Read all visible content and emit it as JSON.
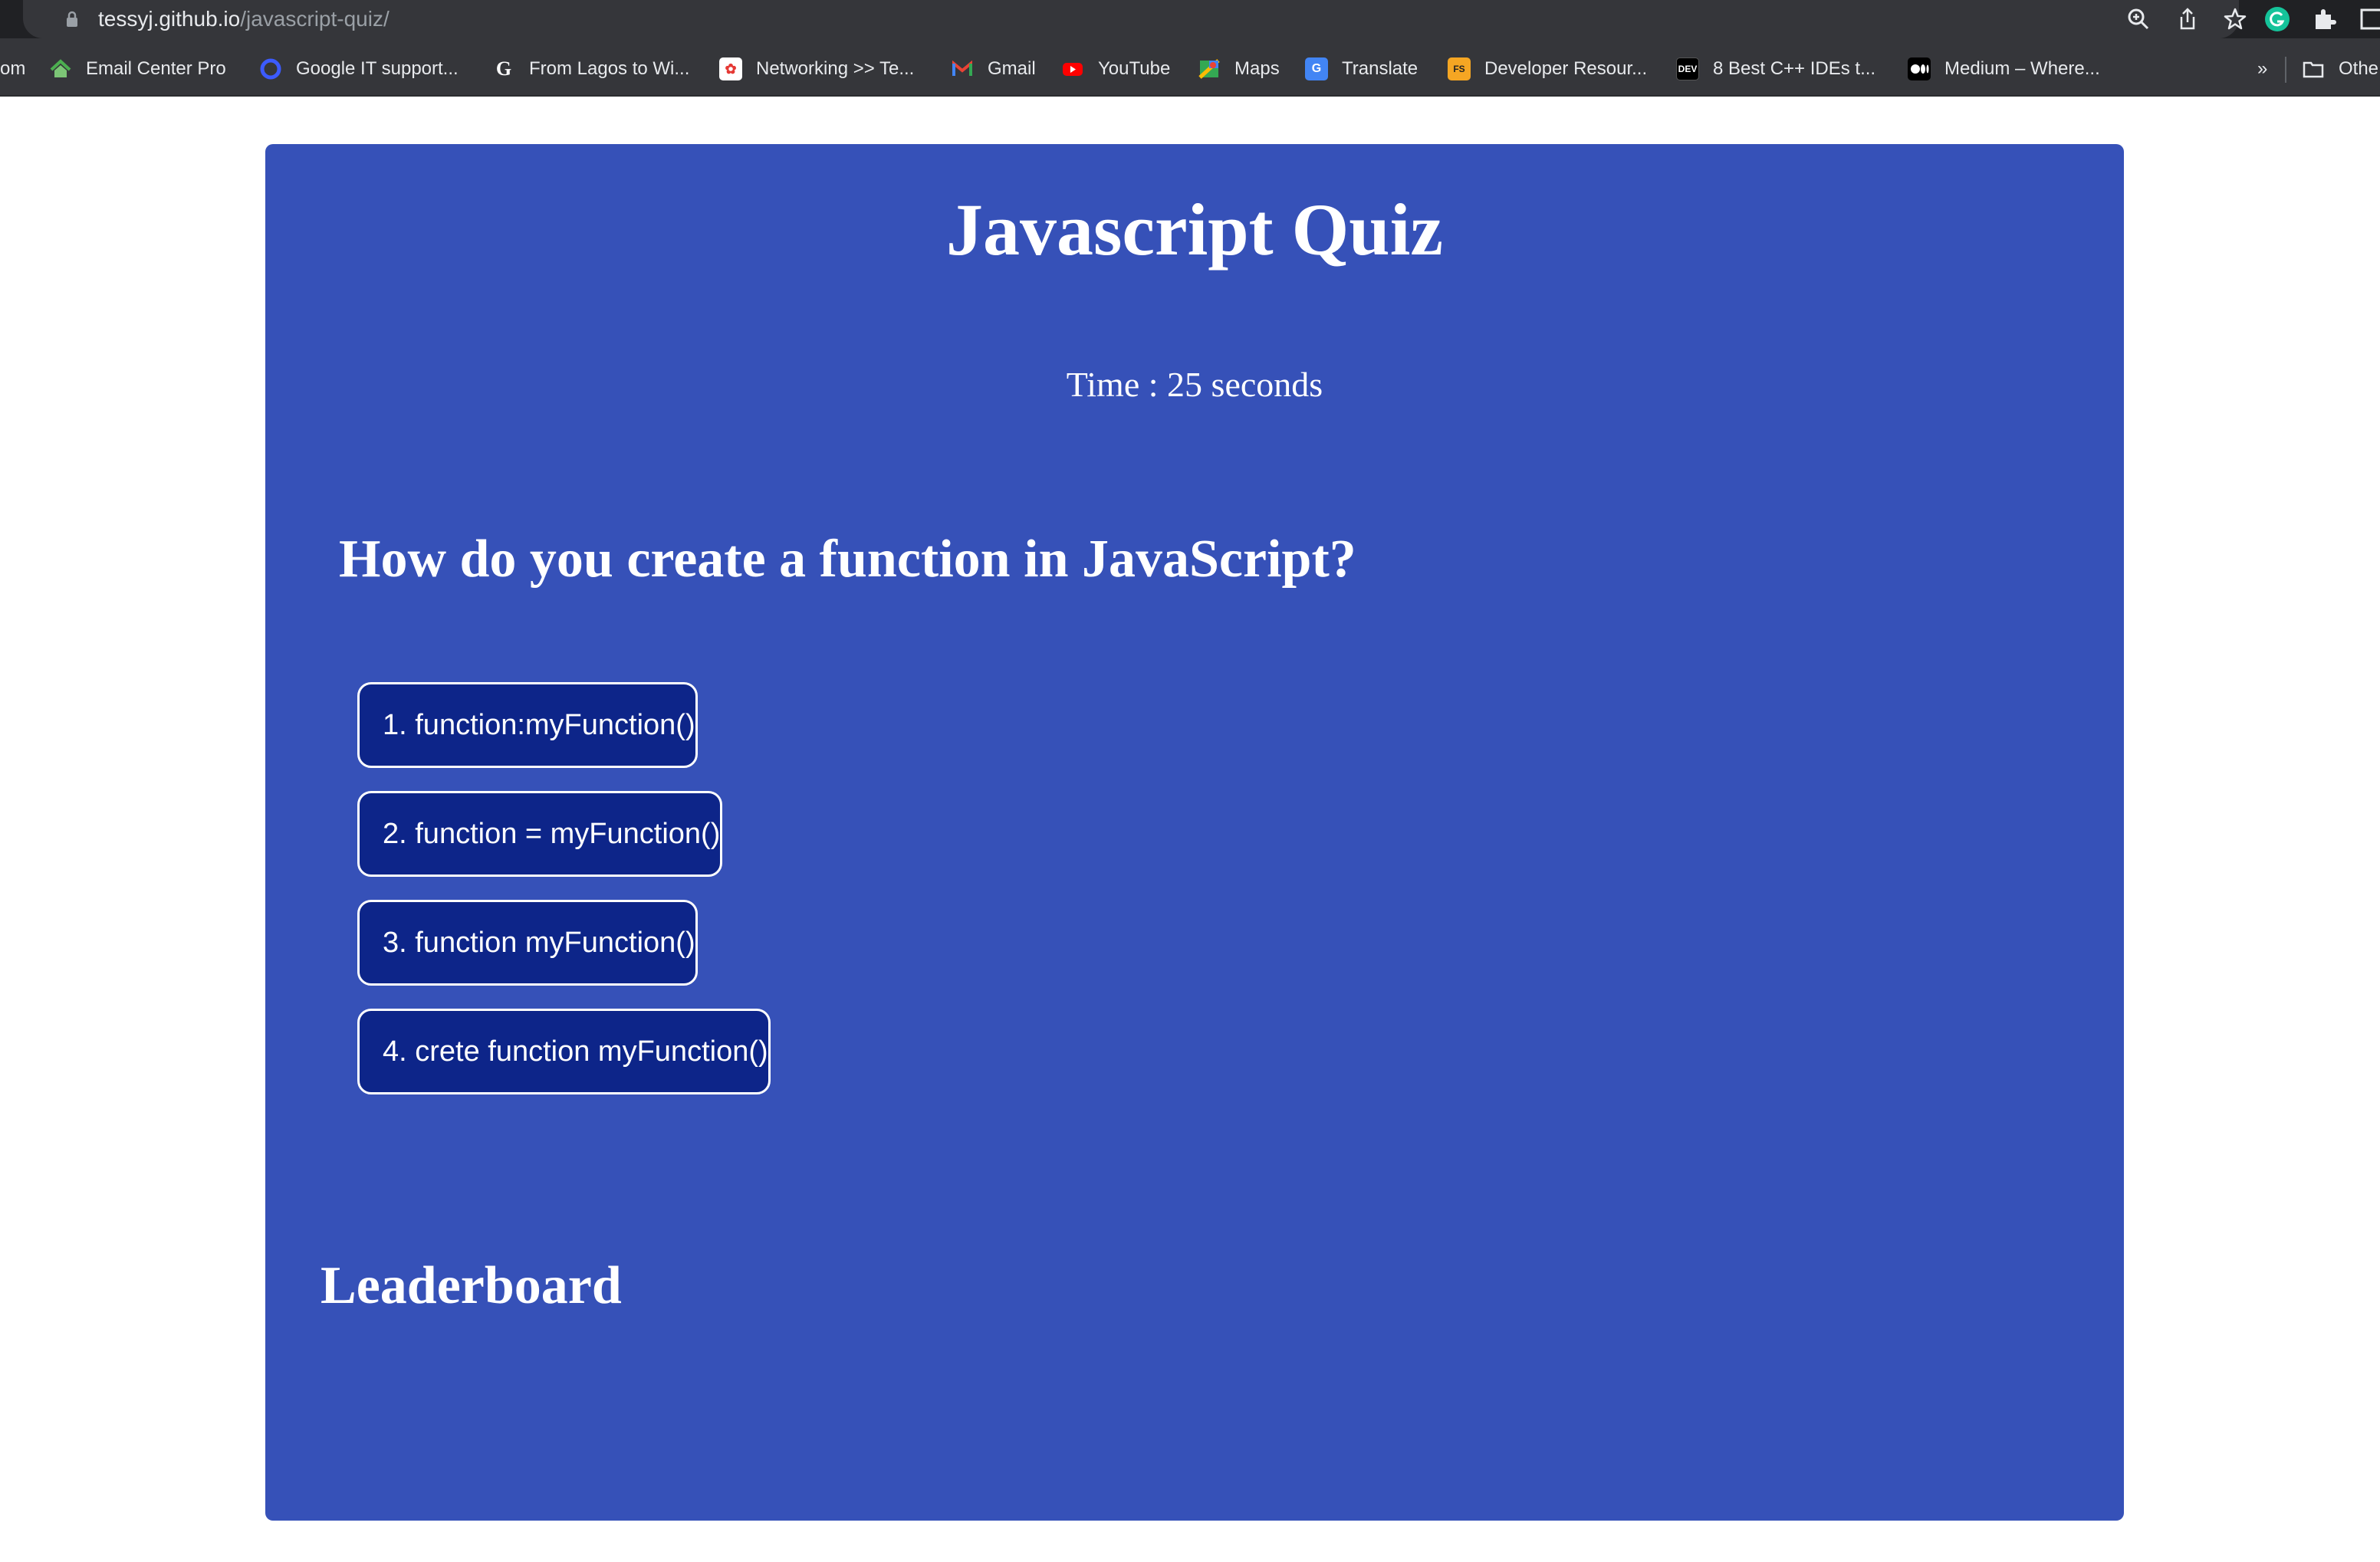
{
  "browser": {
    "url_host": "tessyj.github.io",
    "url_path": "/javascript-quiz/"
  },
  "bookmarks": {
    "overflow_text": "om",
    "items": [
      {
        "label": "Email Center Pro",
        "icon": "house-icon",
        "color": "#4caf50"
      },
      {
        "label": "Google IT support...",
        "icon": "circle-icon",
        "color": "#3c5bff"
      },
      {
        "label": "From Lagos to Wi...",
        "icon": "g-icon",
        "color": "#ffffff"
      },
      {
        "label": "Networking >> Te...",
        "icon": "app-icon",
        "color": "#e53935"
      },
      {
        "label": "Gmail",
        "icon": "gmail-icon",
        "color": "#ea4335"
      },
      {
        "label": "YouTube",
        "icon": "youtube-icon",
        "color": "#ff0000"
      },
      {
        "label": "Maps",
        "icon": "maps-icon",
        "color": "#34a853"
      },
      {
        "label": "Translate",
        "icon": "translate-icon",
        "color": "#4285f4"
      },
      {
        "label": "Developer Resour...",
        "icon": "fs-icon",
        "color": "#f5a623"
      },
      {
        "label": "8 Best C++ IDEs t...",
        "icon": "dev-icon",
        "color": "#000000"
      },
      {
        "label": "Medium – Where...",
        "icon": "medium-icon",
        "color": "#000000"
      }
    ],
    "more_label": "»",
    "other_label": "Othe"
  },
  "quiz": {
    "title": "Javascript Quiz",
    "timer_text": "Time : 25 seconds",
    "question": "How do you create a function in JavaScript?",
    "options": [
      "1. function:myFunction()",
      "2. function = myFunction()",
      "3. function myFunction()",
      "4. crete function myFunction()"
    ],
    "leaderboard_title": "Leaderboard"
  },
  "colors": {
    "card": "#3651b8",
    "option_bg": "#0d2589",
    "option_border": "#ffffff"
  }
}
